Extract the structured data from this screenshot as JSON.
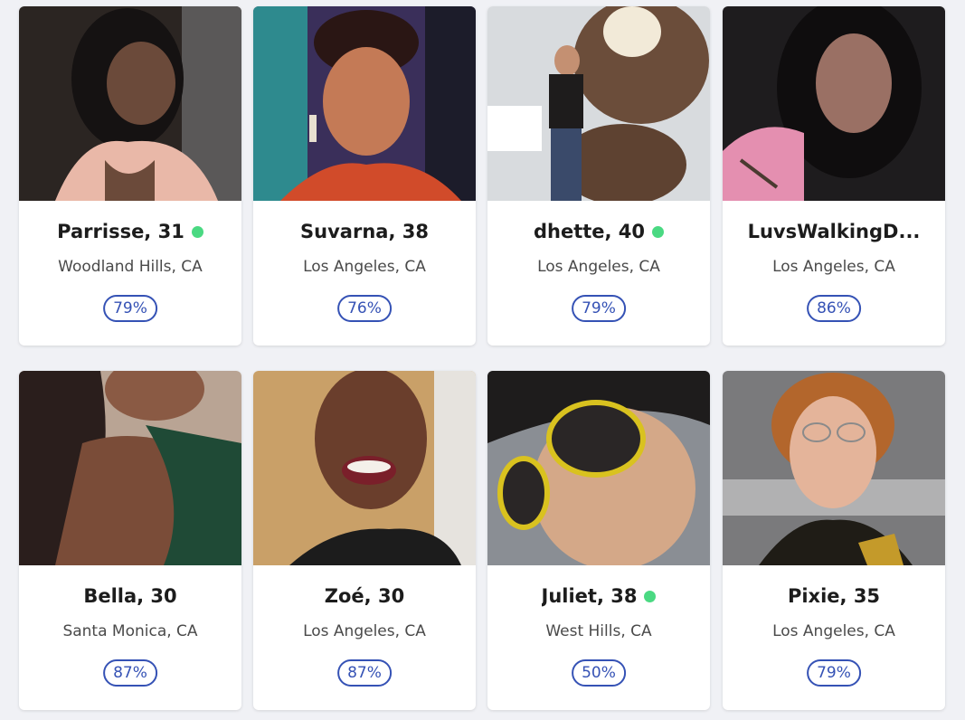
{
  "profiles": [
    {
      "name": "Parrisse, 31",
      "location": "Woodland Hills, CA",
      "match": "79%",
      "online": true,
      "photo_colors": [
        "#2b2522",
        "#6b4a3a",
        "#e9b8a8"
      ]
    },
    {
      "name": "Suvarna, 38",
      "location": "Los Angeles, CA",
      "match": "76%",
      "online": false,
      "photo_colors": [
        "#3a2f5a",
        "#c47a56",
        "#d14b2a"
      ]
    },
    {
      "name": "dhette, 40",
      "location": "Los Angeles, CA",
      "match": "79%",
      "online": true,
      "photo_colors": [
        "#d8dbde",
        "#6b4d3a",
        "#1e1c1c"
      ]
    },
    {
      "name": "LuvsWalkingD...",
      "location": "Los Angeles, CA",
      "match": "86%",
      "online": false,
      "photo_colors": [
        "#1e1c1e",
        "#9a7064",
        "#e48fb0"
      ]
    },
    {
      "name": "Bella, 30",
      "location": "Santa Monica, CA",
      "match": "87%",
      "online": false,
      "photo_colors": [
        "#2a1e1c",
        "#8a5a44",
        "#1f4a36"
      ]
    },
    {
      "name": "Zoé, 30",
      "location": "Los Angeles, CA",
      "match": "87%",
      "online": false,
      "photo_colors": [
        "#c9a068",
        "#6a3e2c",
        "#1c1c1c"
      ]
    },
    {
      "name": "Juliet, 38",
      "location": "West Hills, CA",
      "match": "50%",
      "online": true,
      "photo_colors": [
        "#8a8e94",
        "#d4a888",
        "#d9c21f"
      ]
    },
    {
      "name": "Pixie, 35",
      "location": "Los Angeles, CA",
      "match": "79%",
      "online": false,
      "photo_colors": [
        "#7a7a7c",
        "#e4b49a",
        "#1f1c16"
      ]
    }
  ],
  "accent_color": "#3552b5",
  "online_color": "#4ad982"
}
